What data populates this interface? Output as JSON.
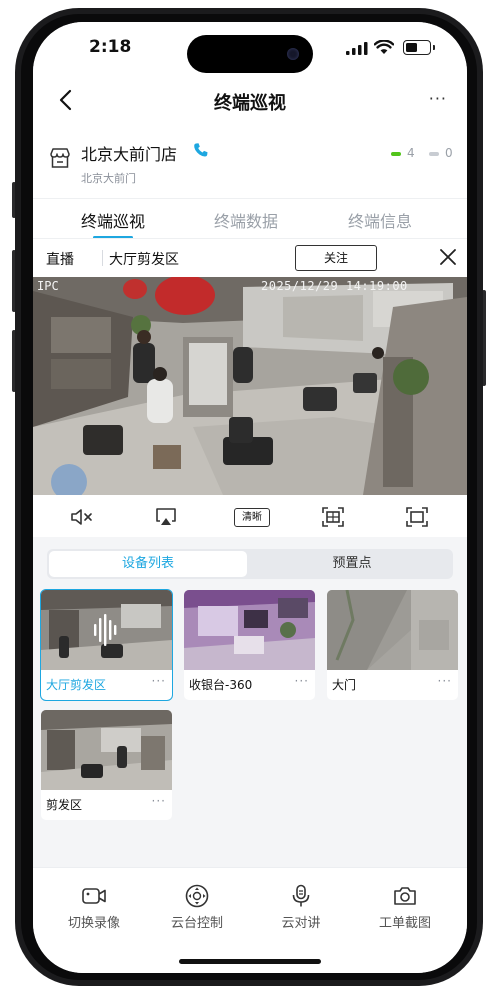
{
  "status": {
    "time": "2:18"
  },
  "nav": {
    "title": "终端巡视",
    "back_icon": "chevron-left-icon",
    "more_icon": "more-dots-icon"
  },
  "store": {
    "name": "北京大前门店",
    "address": "北京大前门",
    "online_count": "4",
    "offline_count": "0",
    "online_color": "#52c41a",
    "offline_color": "#c8ccd2"
  },
  "tabs": [
    {
      "label": "终端巡视",
      "active": true
    },
    {
      "label": "终端数据",
      "active": false
    },
    {
      "label": "终端信息",
      "active": false
    }
  ],
  "live": {
    "label": "直播",
    "camera": "大厅剪发区",
    "follow_label": "关注"
  },
  "video": {
    "osd_left": "IPC",
    "osd_time": "2025/12/29  14:19:00"
  },
  "video_controls": {
    "hd_label": "清晰",
    "icons": [
      "mute-icon",
      "airplay-icon",
      "hd-icon",
      "fit-screen-icon",
      "fullscreen-icon"
    ]
  },
  "segments": {
    "active": "设备列表",
    "inactive": "预置点"
  },
  "devices": [
    {
      "label": "大厅剪发区",
      "selected": true
    },
    {
      "label": "收银台-360",
      "selected": false
    },
    {
      "label": "大门",
      "selected": false
    },
    {
      "label": "剪发区",
      "selected": false
    }
  ],
  "bottom_actions": [
    {
      "label": "切换录像",
      "icon": "video-camera-icon"
    },
    {
      "label": "云台控制",
      "icon": "ptz-control-icon"
    },
    {
      "label": "云对讲",
      "icon": "microphone-icon"
    },
    {
      "label": "工单截图",
      "icon": "camera-snapshot-icon"
    }
  ],
  "colors": {
    "accent": "#1ea7e0",
    "background": "#f4f5f7"
  }
}
